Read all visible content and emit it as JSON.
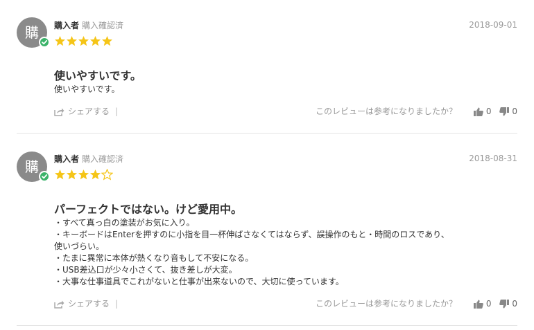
{
  "reviews": [
    {
      "avatar_char": "購",
      "reviewer": "購入者",
      "badge": "購入確認済",
      "date": "2018-09-01",
      "rating": 5,
      "title": "使いやすいです。",
      "body": [
        "使いやすいです。"
      ],
      "share_label": "シェアする",
      "share_sep": "|",
      "helpful_question": "このレビューは参考になりましたか？",
      "upvotes": "0",
      "downvotes": "0"
    },
    {
      "avatar_char": "購",
      "reviewer": "購入者",
      "badge": "購入確認済",
      "date": "2018-08-31",
      "rating": 4,
      "title": "パーフェクトではない。けど愛用中。",
      "body": [
        "・すべて真っ白の塗装がお気に入り。",
        "・キーボードはEnterを押すのに小指を目一杯伸ばさなくてはならず、誤操作のもと・時間のロスであり、",
        "使いづらい。",
        "・たまに異常に本体が熱くなり音もして不安になる。",
        "・USB差込口が少々小さくて、抜き差しが大変。",
        "・大事な仕事道具でこれがないと仕事が出来ないので、大切に使っています。"
      ],
      "share_label": "シェアする",
      "share_sep": "|",
      "helpful_question": "このレビューは参考になりましたか？",
      "upvotes": "0",
      "downvotes": "0"
    }
  ],
  "icons": {
    "star_filled": "star-filled-icon",
    "star_empty": "star-empty-icon",
    "share": "share-icon",
    "thumbs_up": "thumbs-up-icon",
    "thumbs_down": "thumbs-down-icon",
    "verified": "check-icon"
  },
  "colors": {
    "star": "#f5c518",
    "verified": "#3bb36a",
    "avatar": "#8a8a8a",
    "muted_text": "#999999",
    "divider": "#e5e5e5"
  }
}
